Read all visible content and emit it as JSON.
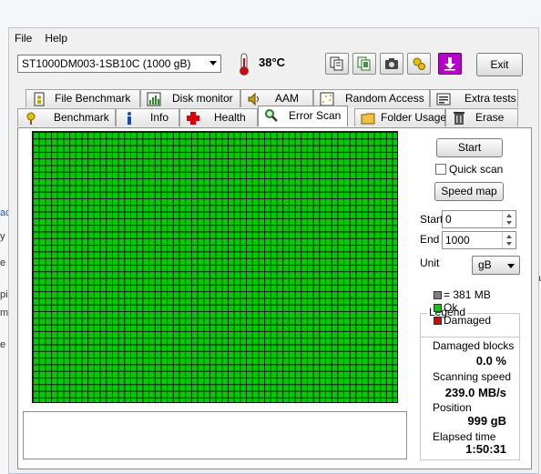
{
  "background": {
    "fragments": [
      "ac",
      "y",
      "e",
      "pi",
      "m",
      "e i"
    ],
    "right_fragment": "a"
  },
  "menu": {
    "file": "File",
    "help": "Help"
  },
  "toolbar": {
    "drive": "ST1000DM003-1SB10C (1000 gB)",
    "temperature": "38°C",
    "exit_label": "Exit",
    "icons": [
      "copy-text-icon",
      "copy-info-icon",
      "screenshot-camera-icon",
      "options-icon",
      "save-download-icon"
    ]
  },
  "tabs": {
    "top_row": [
      {
        "label": "File Benchmark",
        "icon": "file-benchmark-icon"
      },
      {
        "label": "Disk monitor",
        "icon": "disk-monitor-icon"
      },
      {
        "label": "AAM",
        "icon": "speaker-icon"
      },
      {
        "label": "Random Access",
        "icon": "random-access-icon"
      },
      {
        "label": "Extra tests",
        "icon": "extra-tests-icon"
      }
    ],
    "bottom_row": [
      {
        "label": "Benchmark",
        "icon": "benchmark-icon"
      },
      {
        "label": "Info",
        "icon": "info-icon"
      },
      {
        "label": "Health",
        "icon": "health-cross-icon"
      },
      {
        "label": "Error Scan",
        "icon": "magnifier-icon",
        "active": true
      },
      {
        "label": "Folder Usage",
        "icon": "folder-icon"
      },
      {
        "label": "Erase",
        "icon": "trash-icon"
      }
    ]
  },
  "error_scan": {
    "start_button": "Start",
    "quick_scan_label": "Quick scan",
    "quick_scan_checked": false,
    "speed_map_button": "Speed map",
    "start_label": "Start",
    "start_value": "0",
    "end_label": "End",
    "end_value": "1000",
    "unit_label": "Unit",
    "unit_value": "gB",
    "legend": {
      "title": "Legend",
      "block_size": "= 381 MB",
      "ok": "Ok",
      "damaged": "Damaged"
    },
    "stats": {
      "damaged_blocks_label": "Damaged blocks",
      "damaged_blocks_value": "0.0 %",
      "scanning_speed_label": "Scanning speed",
      "scanning_speed_value": "239.0 MB/s",
      "position_label": "Position",
      "position_value": "999 gB",
      "elapsed_label": "Elapsed time",
      "elapsed_value": "1:50:31"
    },
    "colors": {
      "ok": "#00cc00",
      "damaged": "#dd0000",
      "block": "#808080"
    }
  }
}
